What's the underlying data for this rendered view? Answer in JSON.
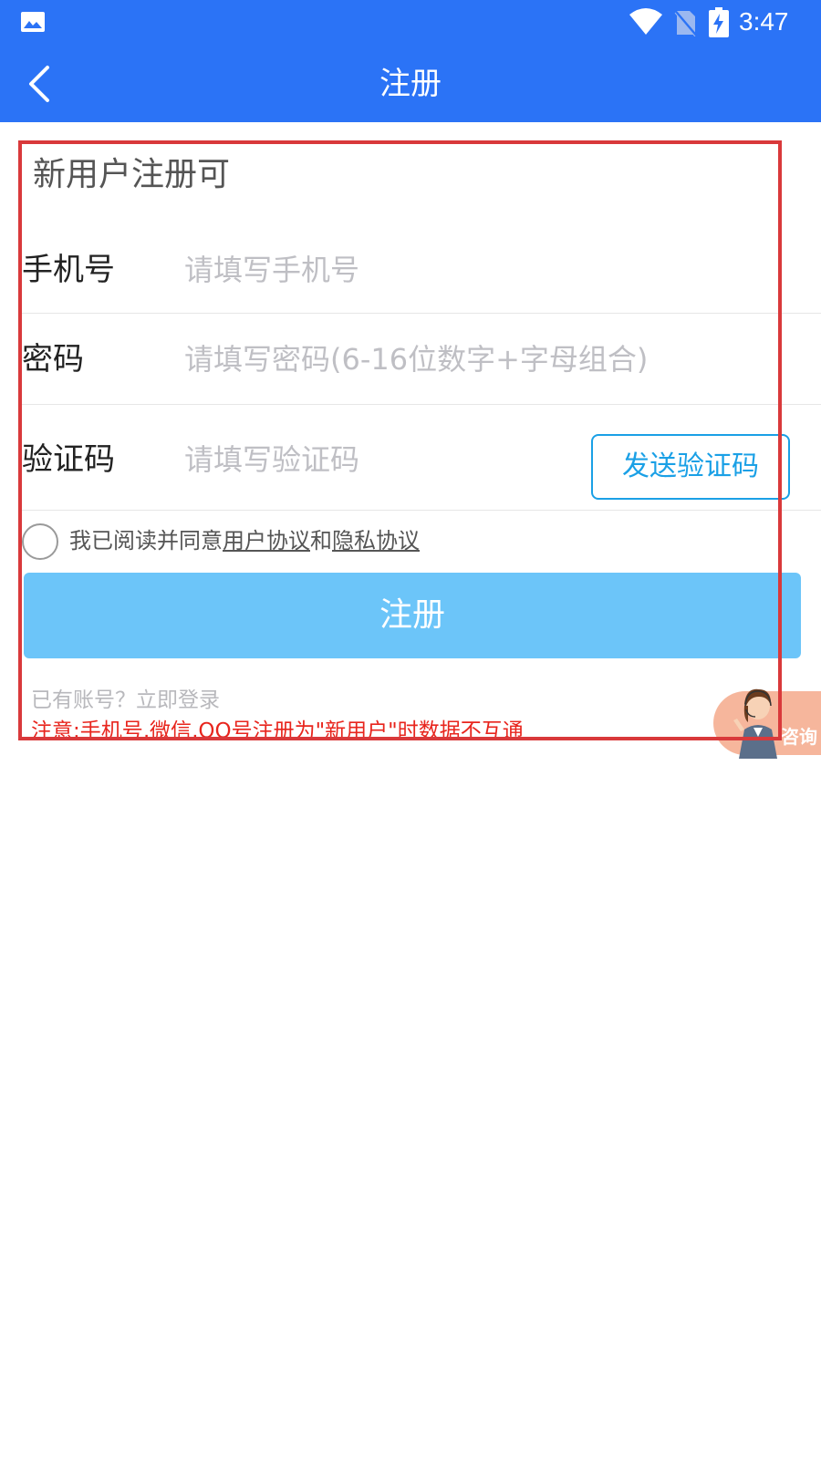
{
  "status_bar": {
    "time": "3:47",
    "icons": [
      "image-icon",
      "wifi-icon",
      "no-sim-icon",
      "battery-charging-icon"
    ]
  },
  "header": {
    "title": "注册",
    "back_icon": "chevron-left-icon"
  },
  "form": {
    "heading": "新用户注册可",
    "phone": {
      "label": "手机号",
      "placeholder": "请填写手机号",
      "value": ""
    },
    "password": {
      "label": "密码",
      "placeholder": "请填写密码(6-16位数字+字母组合)",
      "value": ""
    },
    "code": {
      "label": "验证码",
      "placeholder": "请填写验证码",
      "value": "",
      "send_button": "发送验证码"
    },
    "agreement": {
      "prefix": "我已阅读并同意",
      "user_agreement": "用户协议",
      "and": "和",
      "privacy_agreement": "隐私协议",
      "checked": false
    },
    "submit_label": "注册",
    "login_link": "已有账号？立即登录",
    "notice": "注意:手机号,微信,QQ号注册为\"新用户\"时数据不互通"
  },
  "consult": {
    "label": "咨询",
    "icon": "customer-service-agent-icon"
  },
  "colors": {
    "primary": "#2b73f6",
    "button": "#6cc5f9",
    "accent": "#1aa0e6",
    "notice": "#e8251d",
    "highlight_frame": "#d9393b"
  }
}
